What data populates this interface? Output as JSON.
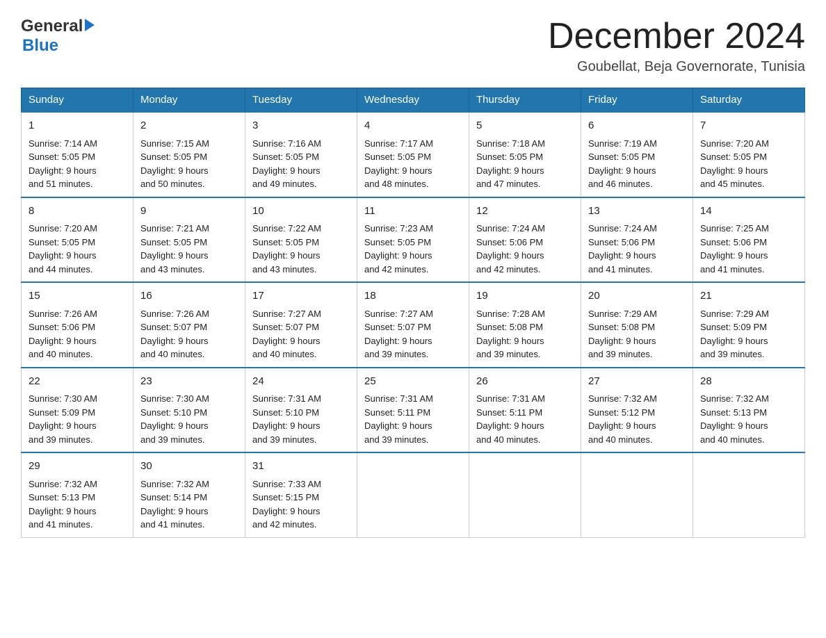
{
  "header": {
    "logo": {
      "text1": "General",
      "text2": "Blue"
    },
    "title": "December 2024",
    "location": "Goubellat, Beja Governorate, Tunisia"
  },
  "calendar": {
    "days": [
      "Sunday",
      "Monday",
      "Tuesday",
      "Wednesday",
      "Thursday",
      "Friday",
      "Saturday"
    ],
    "weeks": [
      [
        {
          "day": "1",
          "sunrise": "7:14 AM",
          "sunset": "5:05 PM",
          "daylight": "9 hours and 51 minutes."
        },
        {
          "day": "2",
          "sunrise": "7:15 AM",
          "sunset": "5:05 PM",
          "daylight": "9 hours and 50 minutes."
        },
        {
          "day": "3",
          "sunrise": "7:16 AM",
          "sunset": "5:05 PM",
          "daylight": "9 hours and 49 minutes."
        },
        {
          "day": "4",
          "sunrise": "7:17 AM",
          "sunset": "5:05 PM",
          "daylight": "9 hours and 48 minutes."
        },
        {
          "day": "5",
          "sunrise": "7:18 AM",
          "sunset": "5:05 PM",
          "daylight": "9 hours and 47 minutes."
        },
        {
          "day": "6",
          "sunrise": "7:19 AM",
          "sunset": "5:05 PM",
          "daylight": "9 hours and 46 minutes."
        },
        {
          "day": "7",
          "sunrise": "7:20 AM",
          "sunset": "5:05 PM",
          "daylight": "9 hours and 45 minutes."
        }
      ],
      [
        {
          "day": "8",
          "sunrise": "7:20 AM",
          "sunset": "5:05 PM",
          "daylight": "9 hours and 44 minutes."
        },
        {
          "day": "9",
          "sunrise": "7:21 AM",
          "sunset": "5:05 PM",
          "daylight": "9 hours and 43 minutes."
        },
        {
          "day": "10",
          "sunrise": "7:22 AM",
          "sunset": "5:05 PM",
          "daylight": "9 hours and 43 minutes."
        },
        {
          "day": "11",
          "sunrise": "7:23 AM",
          "sunset": "5:05 PM",
          "daylight": "9 hours and 42 minutes."
        },
        {
          "day": "12",
          "sunrise": "7:24 AM",
          "sunset": "5:06 PM",
          "daylight": "9 hours and 42 minutes."
        },
        {
          "day": "13",
          "sunrise": "7:24 AM",
          "sunset": "5:06 PM",
          "daylight": "9 hours and 41 minutes."
        },
        {
          "day": "14",
          "sunrise": "7:25 AM",
          "sunset": "5:06 PM",
          "daylight": "9 hours and 41 minutes."
        }
      ],
      [
        {
          "day": "15",
          "sunrise": "7:26 AM",
          "sunset": "5:06 PM",
          "daylight": "9 hours and 40 minutes."
        },
        {
          "day": "16",
          "sunrise": "7:26 AM",
          "sunset": "5:07 PM",
          "daylight": "9 hours and 40 minutes."
        },
        {
          "day": "17",
          "sunrise": "7:27 AM",
          "sunset": "5:07 PM",
          "daylight": "9 hours and 40 minutes."
        },
        {
          "day": "18",
          "sunrise": "7:27 AM",
          "sunset": "5:07 PM",
          "daylight": "9 hours and 39 minutes."
        },
        {
          "day": "19",
          "sunrise": "7:28 AM",
          "sunset": "5:08 PM",
          "daylight": "9 hours and 39 minutes."
        },
        {
          "day": "20",
          "sunrise": "7:29 AM",
          "sunset": "5:08 PM",
          "daylight": "9 hours and 39 minutes."
        },
        {
          "day": "21",
          "sunrise": "7:29 AM",
          "sunset": "5:09 PM",
          "daylight": "9 hours and 39 minutes."
        }
      ],
      [
        {
          "day": "22",
          "sunrise": "7:30 AM",
          "sunset": "5:09 PM",
          "daylight": "9 hours and 39 minutes."
        },
        {
          "day": "23",
          "sunrise": "7:30 AM",
          "sunset": "5:10 PM",
          "daylight": "9 hours and 39 minutes."
        },
        {
          "day": "24",
          "sunrise": "7:31 AM",
          "sunset": "5:10 PM",
          "daylight": "9 hours and 39 minutes."
        },
        {
          "day": "25",
          "sunrise": "7:31 AM",
          "sunset": "5:11 PM",
          "daylight": "9 hours and 39 minutes."
        },
        {
          "day": "26",
          "sunrise": "7:31 AM",
          "sunset": "5:11 PM",
          "daylight": "9 hours and 40 minutes."
        },
        {
          "day": "27",
          "sunrise": "7:32 AM",
          "sunset": "5:12 PM",
          "daylight": "9 hours and 40 minutes."
        },
        {
          "day": "28",
          "sunrise": "7:32 AM",
          "sunset": "5:13 PM",
          "daylight": "9 hours and 40 minutes."
        }
      ],
      [
        {
          "day": "29",
          "sunrise": "7:32 AM",
          "sunset": "5:13 PM",
          "daylight": "9 hours and 41 minutes."
        },
        {
          "day": "30",
          "sunrise": "7:32 AM",
          "sunset": "5:14 PM",
          "daylight": "9 hours and 41 minutes."
        },
        {
          "day": "31",
          "sunrise": "7:33 AM",
          "sunset": "5:15 PM",
          "daylight": "9 hours and 42 minutes."
        },
        null,
        null,
        null,
        null
      ]
    ],
    "labels": {
      "sunrise": "Sunrise:",
      "sunset": "Sunset:",
      "daylight": "Daylight:"
    }
  }
}
